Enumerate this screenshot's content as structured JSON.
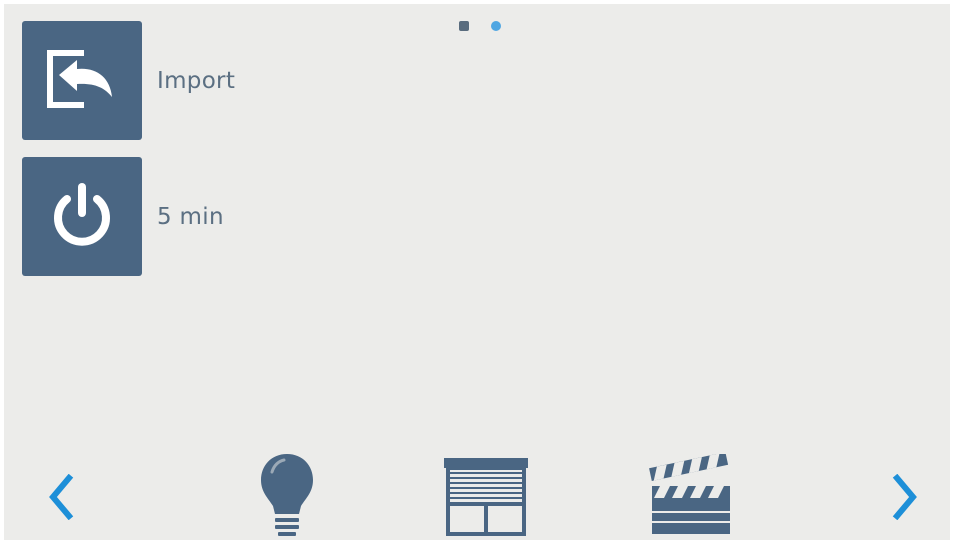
{
  "pager": {
    "pages": 2,
    "current": 2
  },
  "tiles": [
    {
      "label": "Import",
      "icon": "import-icon"
    },
    {
      "label": "5 min",
      "icon": "power-icon"
    }
  ],
  "dock": {
    "items": [
      {
        "icon": "lightbulb-icon"
      },
      {
        "icon": "blinds-icon"
      },
      {
        "icon": "clapperboard-icon"
      }
    ],
    "prev_icon": "chevron-left-icon",
    "next_icon": "chevron-right-icon"
  },
  "colors": {
    "background": "#ececea",
    "tile": "#4a6683",
    "label": "#5b6f82",
    "accent": "#1d8fd8",
    "dock_icon": "#4a6683"
  }
}
